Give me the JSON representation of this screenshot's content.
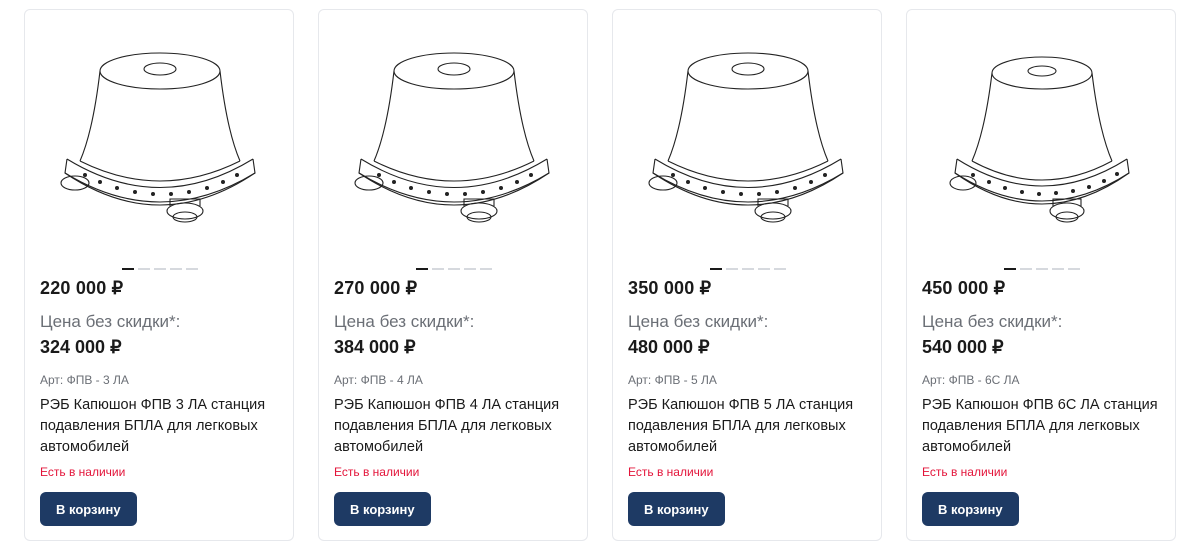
{
  "products": [
    {
      "price": "220 000 ₽",
      "old_price_label": "Цена без скидки*:",
      "old_price": "324 000 ₽",
      "sku": "Арт: ФПВ - 3 ЛА",
      "title": "РЭБ Капюшон ФПВ 3 ЛА станция подавления БПЛА для легковых автомобилей",
      "stock": "Есть в наличии",
      "button": "В корзину"
    },
    {
      "price": "270 000 ₽",
      "old_price_label": "Цена без скидки*:",
      "old_price": "384 000 ₽",
      "sku": "Арт: ФПВ - 4 ЛА",
      "title": "РЭБ Капюшон ФПВ 4 ЛА станция подавления БПЛА для легковых автомобилей",
      "stock": "Есть в наличии",
      "button": "В корзину"
    },
    {
      "price": "350 000 ₽",
      "old_price_label": "Цена без скидки*:",
      "old_price": "480 000 ₽",
      "sku": "Арт: ФПВ - 5 ЛА",
      "title": "РЭБ Капюшон ФПВ 5 ЛА станция подавления БПЛА для легковых автомобилей",
      "stock": "Есть в наличии",
      "button": "В корзину"
    },
    {
      "price": "450 000 ₽",
      "old_price_label": "Цена без скидки*:",
      "old_price": "540 000 ₽",
      "sku": "Арт: ФПВ - 6С ЛА",
      "title": "РЭБ Капюшон ФПВ 6С ЛА станция подавления БПЛА для легковых автомобилей",
      "stock": "Есть в наличии",
      "button": "В корзину"
    }
  ],
  "colors": {
    "button_bg": "#1e3a64",
    "stock_red": "#e3143a",
    "muted_text": "#6b6f76"
  },
  "icons": {
    "product_image": "dome-device-drawing-icon"
  },
  "gallery": {
    "dot_count": 5,
    "active_dot": 0
  }
}
